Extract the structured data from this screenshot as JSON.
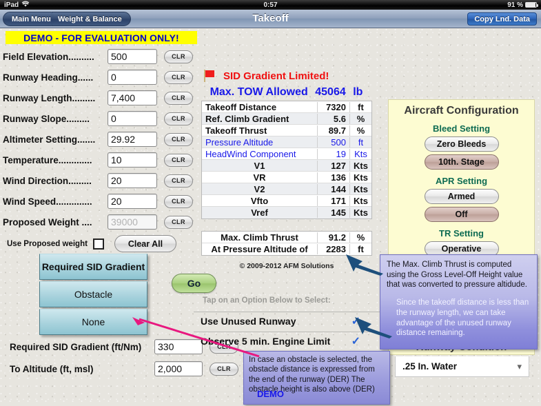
{
  "statusbar": {
    "device": "iPad",
    "wifi_icon": "wifi-icon",
    "time": "0:57",
    "battery": "91 %"
  },
  "navbar": {
    "crumbs": [
      "Main Menu",
      "Weight & Balance"
    ],
    "title": "Takeoff",
    "copy_button": "Copy Lnd. Data"
  },
  "demo_banner": "DEMO - FOR EVALUATION ONLY!",
  "demo_footer": "DEMO",
  "inputs": {
    "clr_label": "CLR",
    "rows": [
      {
        "label": "Field Elevation..........",
        "value": "500"
      },
      {
        "label": "Runway Heading......",
        "value": "0"
      },
      {
        "label": "Runway Length.........",
        "value": "7,400"
      },
      {
        "label": "Runway Slope.........",
        "value": "0"
      },
      {
        "label": "Altimeter Setting.......",
        "value": "29.92"
      },
      {
        "label": "Temperature.............",
        "value": "10"
      },
      {
        "label": "Wind Direction.........",
        "value": "20"
      },
      {
        "label": "Wind Speed..............",
        "value": "20"
      },
      {
        "label": "Proposed Weight ....",
        "value": "39000",
        "dim": true
      }
    ]
  },
  "use_proposed": {
    "label": "Use Proposed weight",
    "checked": false
  },
  "clear_all": "Clear All",
  "mode_buttons": [
    {
      "label": "Required SID Gradient",
      "selected": true
    },
    {
      "label": "Obstacle",
      "selected": false
    },
    {
      "label": "None",
      "selected": false
    }
  ],
  "bottom_fields": [
    {
      "label": "Required SID Gradient (ft/Nm)",
      "value": "330",
      "clr": "CLR"
    },
    {
      "label": "To Altitude (ft, msl)",
      "value": "2,000",
      "clr": "CLR"
    }
  ],
  "results": {
    "flag_icon": "red-flag-icon",
    "warning": "SID Gradient Limited!",
    "tow_label": "Max. TOW Allowed",
    "tow_value": "45064",
    "tow_unit": "lb",
    "table1": [
      {
        "name": "Takeoff Distance",
        "value": "7320",
        "unit": "ft",
        "blue": false,
        "center": false
      },
      {
        "name": "Ref. Climb Gradient",
        "value": "5.6",
        "unit": "%",
        "blue": false,
        "center": false
      },
      {
        "name": "Takeoff Thrust",
        "value": "89.7",
        "unit": "%",
        "blue": false,
        "center": false
      },
      {
        "name": "Pressure Altitude",
        "value": "500",
        "unit": "ft",
        "blue": true,
        "center": false
      },
      {
        "name": "HeadWind Component",
        "value": "19",
        "unit": "Kts",
        "blue": true,
        "center": false
      },
      {
        "name": "V1",
        "value": "127",
        "unit": "Kts",
        "blue": false,
        "center": true
      },
      {
        "name": "VR",
        "value": "136",
        "unit": "Kts",
        "blue": false,
        "center": true
      },
      {
        "name": "V2",
        "value": "144",
        "unit": "Kts",
        "blue": false,
        "center": true
      },
      {
        "name": "Vfto",
        "value": "171",
        "unit": "Kts",
        "blue": false,
        "center": true
      },
      {
        "name": "Vref",
        "value": "145",
        "unit": "Kts",
        "blue": false,
        "center": true
      }
    ],
    "table2": [
      {
        "name": "Max. Climb Thrust",
        "value": "91.2",
        "unit": "%",
        "blue": false,
        "center": true
      },
      {
        "name": "At Pressure Altitude of",
        "value": "2283",
        "unit": "ft",
        "blue": false,
        "center": true
      }
    ],
    "copyright": "© 2009-2012 AFM Solutions"
  },
  "go_button": "Go",
  "options": {
    "header": "Tap on an Option Below to Select:",
    "items": [
      {
        "label": "Use Unused Runway",
        "checked": true,
        "check_icon": "check-icon"
      },
      {
        "label": "Observe 5 min. Engine Limit",
        "checked": true,
        "check_icon": "check-icon"
      }
    ]
  },
  "config": {
    "title": "Aircraft Configuration",
    "sections": [
      {
        "title": "Bleed Setting",
        "buttons": [
          {
            "label": "Zero Bleeds",
            "selected": false
          },
          {
            "label": "10th. Stage",
            "selected": true
          }
        ]
      },
      {
        "title": "APR Setting",
        "buttons": [
          {
            "label": "Armed",
            "selected": false
          },
          {
            "label": "Off",
            "selected": true
          }
        ]
      },
      {
        "title": "TR Setting",
        "buttons": [
          {
            "label": "Operative",
            "selected": false
          }
        ]
      }
    ],
    "runway_condition_title": "Runway Condition",
    "runway_condition_value": ".25 In. Water",
    "chevron_icon": "chevron-down-icon"
  },
  "tooltips": {
    "tip1_part1": "The Max. Climb Thrust is computed using the Gross Level-Off Height value that was converted to pressure altidude.",
    "tip1_part2": "Since the takeoff distance is less than the runway length, we can take advantage of the unused runway distance remaining.",
    "tip2": "In case an obstacle is selected, the obstacle distance is expressed from the end of the runway (DER) The obstacle height is also above (DER)"
  },
  "colors": {
    "accent_blue": "#1818e8",
    "warning_red": "#f01111",
    "banner_yellow": "#ffff00",
    "panel_yellow": "#fdfcd2",
    "mode_teal": "#a9d3dd",
    "arrow_navy": "#1d4f7c",
    "pointer_pink": "#e8187f",
    "section_green": "#0e6b52"
  }
}
